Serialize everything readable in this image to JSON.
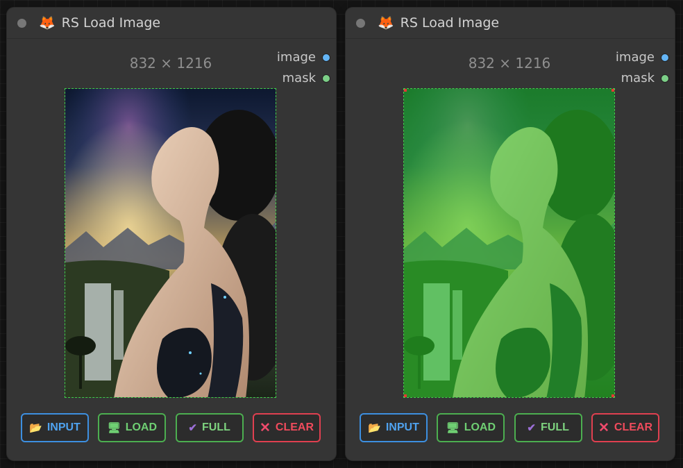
{
  "nodes": [
    {
      "title": "RS Load Image",
      "size_label": "832 × 1216",
      "outputs": {
        "image": "image",
        "mask": "mask"
      },
      "mask_shown": false
    },
    {
      "title": "RS Load Image",
      "size_label": "832 × 1216",
      "outputs": {
        "image": "image",
        "mask": "mask"
      },
      "mask_shown": true
    }
  ],
  "buttons": {
    "input": "INPUT",
    "load": "LOAD",
    "full": "FULL",
    "clear": "CLEAR"
  },
  "icons": {
    "header": "fox-icon",
    "input": "folder-icon",
    "load": "monitor-icon",
    "full": "check-icon",
    "clear": "x-icon"
  },
  "colors": {
    "input": "#3d8fe0",
    "load": "#4caf50",
    "full": "#4caf50",
    "clear": "#e04050",
    "port_image": "#64b5f6",
    "port_mask": "#7ccf87"
  }
}
